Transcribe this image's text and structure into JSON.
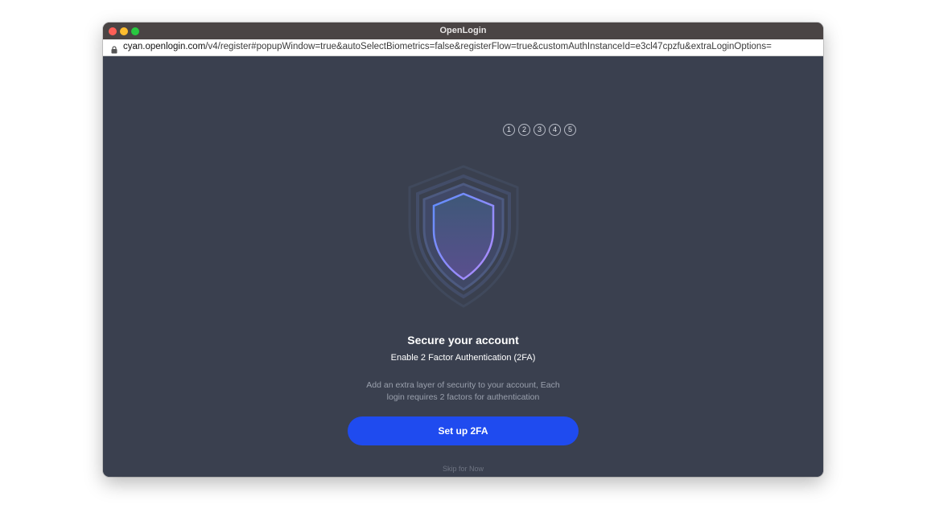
{
  "window": {
    "title": "OpenLogin"
  },
  "address_bar": {
    "host": "cyan.openlogin.com",
    "path": "/v4/register#popupWindow=true&autoSelectBiometrics=false&registerFlow=true&customAuthInstanceId=e3cl47cpzfu&extraLoginOptions="
  },
  "steps": [
    "1",
    "2",
    "3",
    "4",
    "5"
  ],
  "main": {
    "heading": "Secure your account",
    "subheading": "Enable 2 Factor Authentication (2FA)",
    "description_line1": "Add an extra layer of security to your account, Each",
    "description_line2": "login requires 2 factors for authentication",
    "setup_button": "Set up 2FA",
    "skip_link": "Skip for Now"
  },
  "icons": {
    "lock": "lock-icon",
    "shield": "shield-icon"
  },
  "colors": {
    "background": "#3a404f",
    "primary_button": "#1f4bef",
    "shield_outline": "#8f7bff"
  }
}
